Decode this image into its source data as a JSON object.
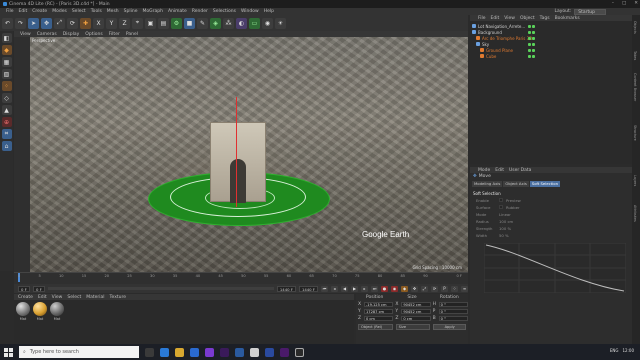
{
  "window": {
    "title": "Cinema 4D Lite (RC) - [Paris 3D.c4d *] - Main",
    "controls": [
      "–",
      "□",
      "✕"
    ]
  },
  "menu": [
    "File",
    "Edit",
    "Create",
    "Modes",
    "Select",
    "Tools",
    "Mesh",
    "Spline",
    "MoGraph",
    "Animate",
    "Render",
    "Selections",
    "Window",
    "Help"
  ],
  "layout": {
    "label": "Layout:",
    "value": "Startup"
  },
  "toolbar": {
    "icons": [
      "undo-icon",
      "redo-icon",
      "live-selection-icon",
      "move-icon",
      "scale-icon",
      "rotate-icon",
      "x-axis-icon",
      "y-axis-icon",
      "z-axis-icon",
      "coordinate-system-icon",
      "render-view-icon",
      "render-picture-viewer-icon",
      "render-settings-icon",
      "cube-icon",
      "pen-icon",
      "subdivision-icon",
      "array-icon",
      "deformer-icon",
      "floor-icon",
      "camera-icon",
      "light-icon"
    ],
    "axes": [
      "X",
      "Y",
      "Z"
    ]
  },
  "viewport_menu": [
    "View",
    "Cameras",
    "Display",
    "Options",
    "Filter",
    "Panel"
  ],
  "viewport": {
    "label": "Perspective",
    "watermark": "Google Earth",
    "grid": "Grid Spacing : 10000 cm"
  },
  "timeline": {
    "ticks": [
      "0",
      "5",
      "10",
      "15",
      "20",
      "25",
      "30",
      "35",
      "40",
      "45",
      "50",
      "55",
      "60",
      "65",
      "70",
      "75",
      "80",
      "85",
      "90"
    ],
    "end": "0 F"
  },
  "playback": {
    "start": "0 F",
    "current": "0 F",
    "end": "1440 F",
    "max": "1440 F"
  },
  "material_menu": [
    "Create",
    "Edit",
    "View",
    "Select",
    "Material",
    "Texture"
  ],
  "materials": [
    {
      "name": "Mat",
      "color": "#9a9a9a"
    },
    {
      "name": "Mat",
      "color": "#d9a030"
    },
    {
      "name": "Mat",
      "color": "#7a7a7a"
    }
  ],
  "coordinates": {
    "headers": [
      "Position",
      "Size",
      "Rotation"
    ],
    "rows": [
      {
        "axis": "X",
        "pos": "-19.125 cm",
        "size": "90452 cm",
        "rot_axis": "H",
        "rot": "0 °"
      },
      {
        "axis": "Y",
        "pos": "17287 cm",
        "size": "90452 cm",
        "rot_axis": "P",
        "rot": "0 °"
      },
      {
        "axis": "Z",
        "pos": "0 cm",
        "size": "0 cm",
        "rot_axis": "B",
        "rot": "0 °"
      }
    ],
    "mode": "Object (Rel)",
    "size_mode": "Size",
    "apply": "Apply"
  },
  "object_menu": [
    "File",
    "Edit",
    "View",
    "Object",
    "Tags",
    "Bookmarks"
  ],
  "objects": [
    {
      "name": "Lot Navigation_Arrete...",
      "indent": 0,
      "color": "#6aa0e0"
    },
    {
      "name": "Background",
      "indent": 0,
      "color": "#6aa0e0"
    },
    {
      "name": "Arc de Triomphe Paris 3D",
      "indent": 1,
      "color": "#e07a30"
    },
    {
      "name": "Sky",
      "indent": 1,
      "color": "#6aa0e0"
    },
    {
      "name": "Ground Plane",
      "indent": 2,
      "color": "#e07a30"
    },
    {
      "name": "Cube",
      "indent": 2,
      "color": "#e07a30"
    }
  ],
  "attr_menu": [
    "Mode",
    "Edit",
    "User Data"
  ],
  "attributes": {
    "mode_label": "Move",
    "tabs": [
      "Modeling Axis",
      "Object Axis",
      "Soft Selection"
    ],
    "active_tab": "Soft Selection",
    "section": "Soft Selection",
    "rows": [
      {
        "label": "Enable",
        "value": "Preview"
      },
      {
        "label": "Surface",
        "value": "Rubber"
      },
      {
        "label": "Mode",
        "value": "Linear"
      },
      {
        "label": "Radius",
        "value": "100 cm"
      },
      {
        "label": "Strength",
        "value": "100 %"
      },
      {
        "label": "Width",
        "value": "50 %"
      }
    ]
  },
  "side_tabs": [
    "Objects",
    "Takes",
    "Content Browser",
    "Structure",
    "Layers",
    "Attributes"
  ],
  "taskbar": {
    "search_placeholder": "Type here to search",
    "tray": [
      "ENG",
      "12:00"
    ]
  }
}
